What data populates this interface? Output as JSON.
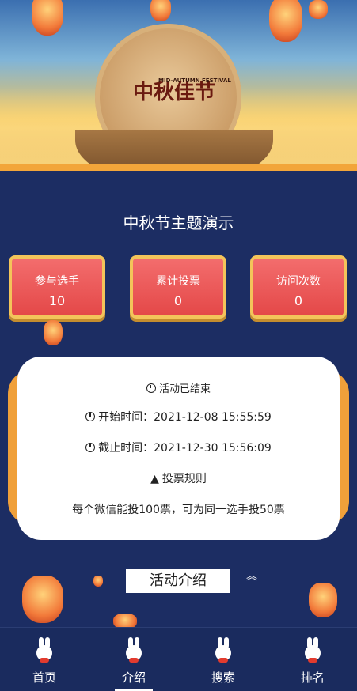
{
  "banner": {
    "festival_title": "中秋佳节",
    "festival_en": "MID-AUTUMN FESTIVAL"
  },
  "page_title": "中秋节主题演示",
  "stats": [
    {
      "label": "参与选手",
      "value": "10"
    },
    {
      "label": "累计投票",
      "value": "0"
    },
    {
      "label": "访问次数",
      "value": "0"
    }
  ],
  "status": {
    "state": "活动已结束",
    "start_label": "开始时间：",
    "start_time": "2021-12-08 15:55:59",
    "end_label": "截止时间：",
    "end_time": "2021-12-30 15:56:09",
    "rules_label": "投票规则",
    "rules_text": "每个微信能投100票，可为同一选手投50票"
  },
  "intro": {
    "label": "活动介绍",
    "toggle_icon": "double-chevron-up-icon"
  },
  "tabs": [
    {
      "label": "首页",
      "icon": "rabbit-icon"
    },
    {
      "label": "介绍",
      "icon": "rabbit-icon"
    },
    {
      "label": "搜索",
      "icon": "rabbit-icon"
    },
    {
      "label": "排名",
      "icon": "rabbit-icon"
    }
  ],
  "active_tab": "介绍",
  "colors": {
    "background": "#1c2d63",
    "stat_card": "#e44848",
    "stat_border": "#f3c45a",
    "card_accent": "#f0a03a"
  }
}
